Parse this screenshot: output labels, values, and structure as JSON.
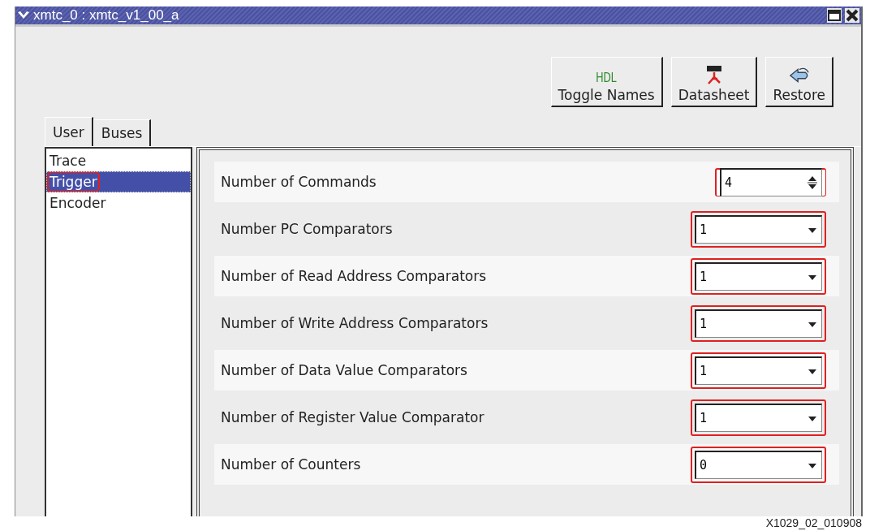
{
  "window": {
    "title": "xmtc_0 : xmtc_v1_00_a"
  },
  "toolbar": [
    {
      "kind": "hdl",
      "icon_text": "HDL",
      "label": "Toggle Names"
    },
    {
      "kind": "pdf",
      "label": "Datasheet"
    },
    {
      "kind": "restore",
      "label": "Restore"
    }
  ],
  "tabs": [
    {
      "label": "User",
      "selected": true
    },
    {
      "label": "Buses",
      "selected": false
    }
  ],
  "sidebar": {
    "items": [
      {
        "label": "Trace",
        "selected": false,
        "highlighted": false
      },
      {
        "label": "Trigger",
        "selected": true,
        "highlighted": true
      },
      {
        "label": "Encoder",
        "selected": false,
        "highlighted": false
      }
    ]
  },
  "parameters": [
    {
      "label": "Number of Commands",
      "kind": "spin",
      "value": "4",
      "highlighted": true
    },
    {
      "label": "Number PC Comparators",
      "kind": "dropdown",
      "value": "1",
      "highlighted": true
    },
    {
      "label": "Number of Read Address Comparators",
      "kind": "dropdown",
      "value": "1",
      "highlighted": true
    },
    {
      "label": "Number of Write Address Comparators",
      "kind": "dropdown",
      "value": "1",
      "highlighted": true
    },
    {
      "label": "Number of Data Value Comparators",
      "kind": "dropdown",
      "value": "1",
      "highlighted": true
    },
    {
      "label": "Number of Register Value Comparator",
      "kind": "dropdown",
      "value": "1",
      "highlighted": true
    },
    {
      "label": "Number of Counters",
      "kind": "dropdown",
      "value": "0",
      "highlighted": true
    }
  ],
  "figure_id": "X1029_02_010908"
}
